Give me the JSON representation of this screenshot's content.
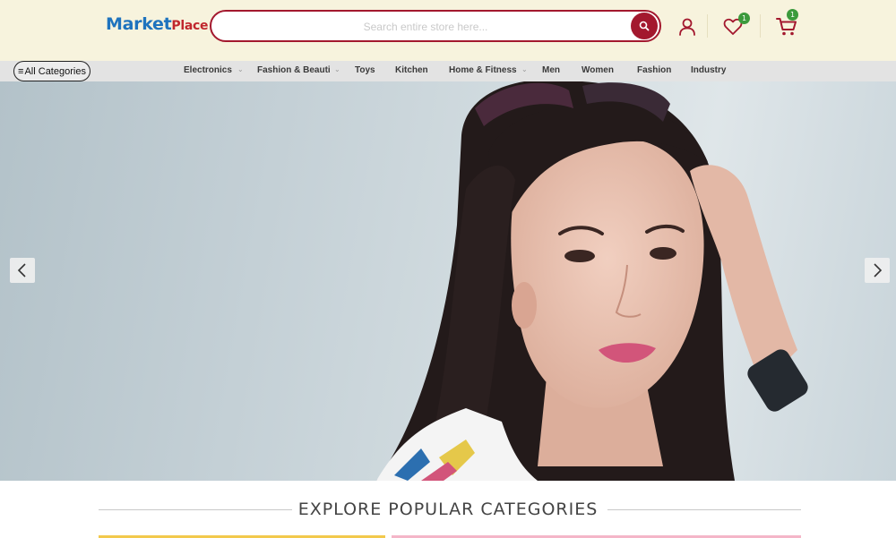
{
  "header": {
    "logo_primary": "Market",
    "logo_secondary": "Place",
    "search": {
      "placeholder": "Search entire store here..."
    },
    "wishlist_count": "1",
    "cart_count": "1",
    "icons": [
      "search-icon",
      "user-icon",
      "heart-icon",
      "cart-icon"
    ]
  },
  "nav": {
    "all_categories_icon": "≡",
    "all_categories_label": "All Categories",
    "items": [
      {
        "label": "Electronics",
        "has_dropdown": true
      },
      {
        "label": "Fashion & Beauti",
        "has_dropdown": true
      },
      {
        "label": "Toys",
        "has_dropdown": false
      },
      {
        "label": "Kitchen",
        "has_dropdown": false
      },
      {
        "label": "Home & Fitness",
        "has_dropdown": true
      },
      {
        "label": "Men",
        "has_dropdown": false
      },
      {
        "label": "Women",
        "has_dropdown": false
      },
      {
        "label": "Fashion",
        "has_dropdown": false
      },
      {
        "label": "Industry",
        "has_dropdown": false
      }
    ]
  },
  "hero": {
    "prev_icon": "chevron-left-icon",
    "next_icon": "chevron-right-icon"
  },
  "explore": {
    "title": "EXPLORE POPULAR CATEGORIES"
  },
  "colors": {
    "brand_blue": "#1e73be",
    "brand_red": "#c0272d",
    "accent": "#a3182e",
    "badge_green": "#3c9a3c",
    "header_bg": "#f7f3dd",
    "cat_bar_1": "#f2c94c",
    "cat_bar_2": "#f4b6c8"
  }
}
